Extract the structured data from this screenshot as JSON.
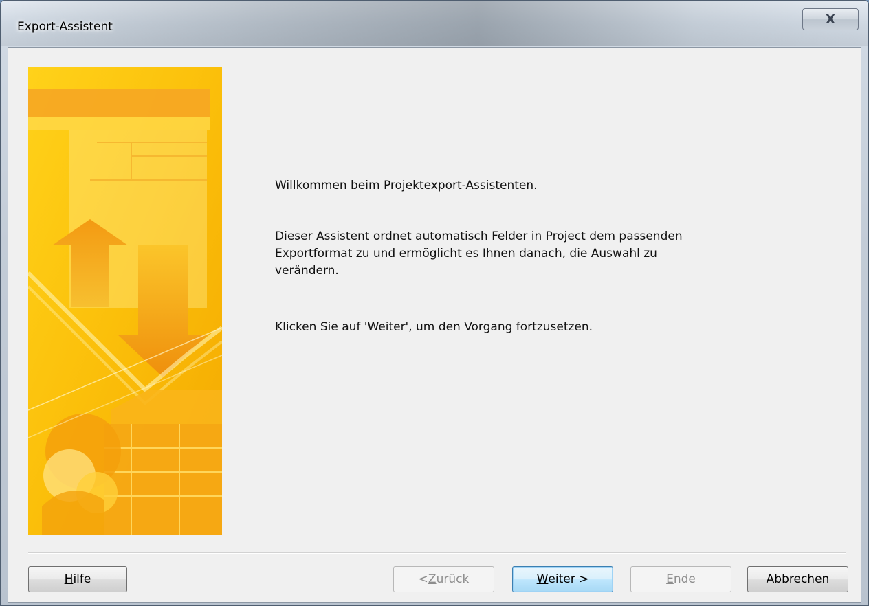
{
  "window": {
    "title": "Export-Assistent",
    "close_label": "X"
  },
  "content": {
    "welcome": "Willkommen beim Projektexport-Assistenten.",
    "description": "Dieser Assistent ordnet automatisch Felder in Project dem passenden Exportformat zu und ermöglicht es Ihnen danach, die Auswahl zu verändern.",
    "hint": "Klicken Sie auf 'Weiter', um den Vorgang fortzusetzen."
  },
  "buttons": {
    "help": {
      "prefix": "",
      "accel": "H",
      "suffix": "ilfe",
      "enabled": true
    },
    "back": {
      "prefix": "< ",
      "accel": "Z",
      "suffix": "urück",
      "enabled": false
    },
    "next": {
      "prefix": "",
      "accel": "W",
      "suffix": "eiter >",
      "enabled": true
    },
    "finish": {
      "prefix": "",
      "accel": "E",
      "suffix": "nde",
      "enabled": false
    },
    "cancel": {
      "prefix": "",
      "accel": "",
      "suffix": "Abbrechen",
      "enabled": true
    }
  },
  "colors": {
    "banner_primary": "#f7b500",
    "banner_light": "#ffe566",
    "banner_accent": "#f08a10",
    "dialog_bg": "#f0f0f0"
  }
}
